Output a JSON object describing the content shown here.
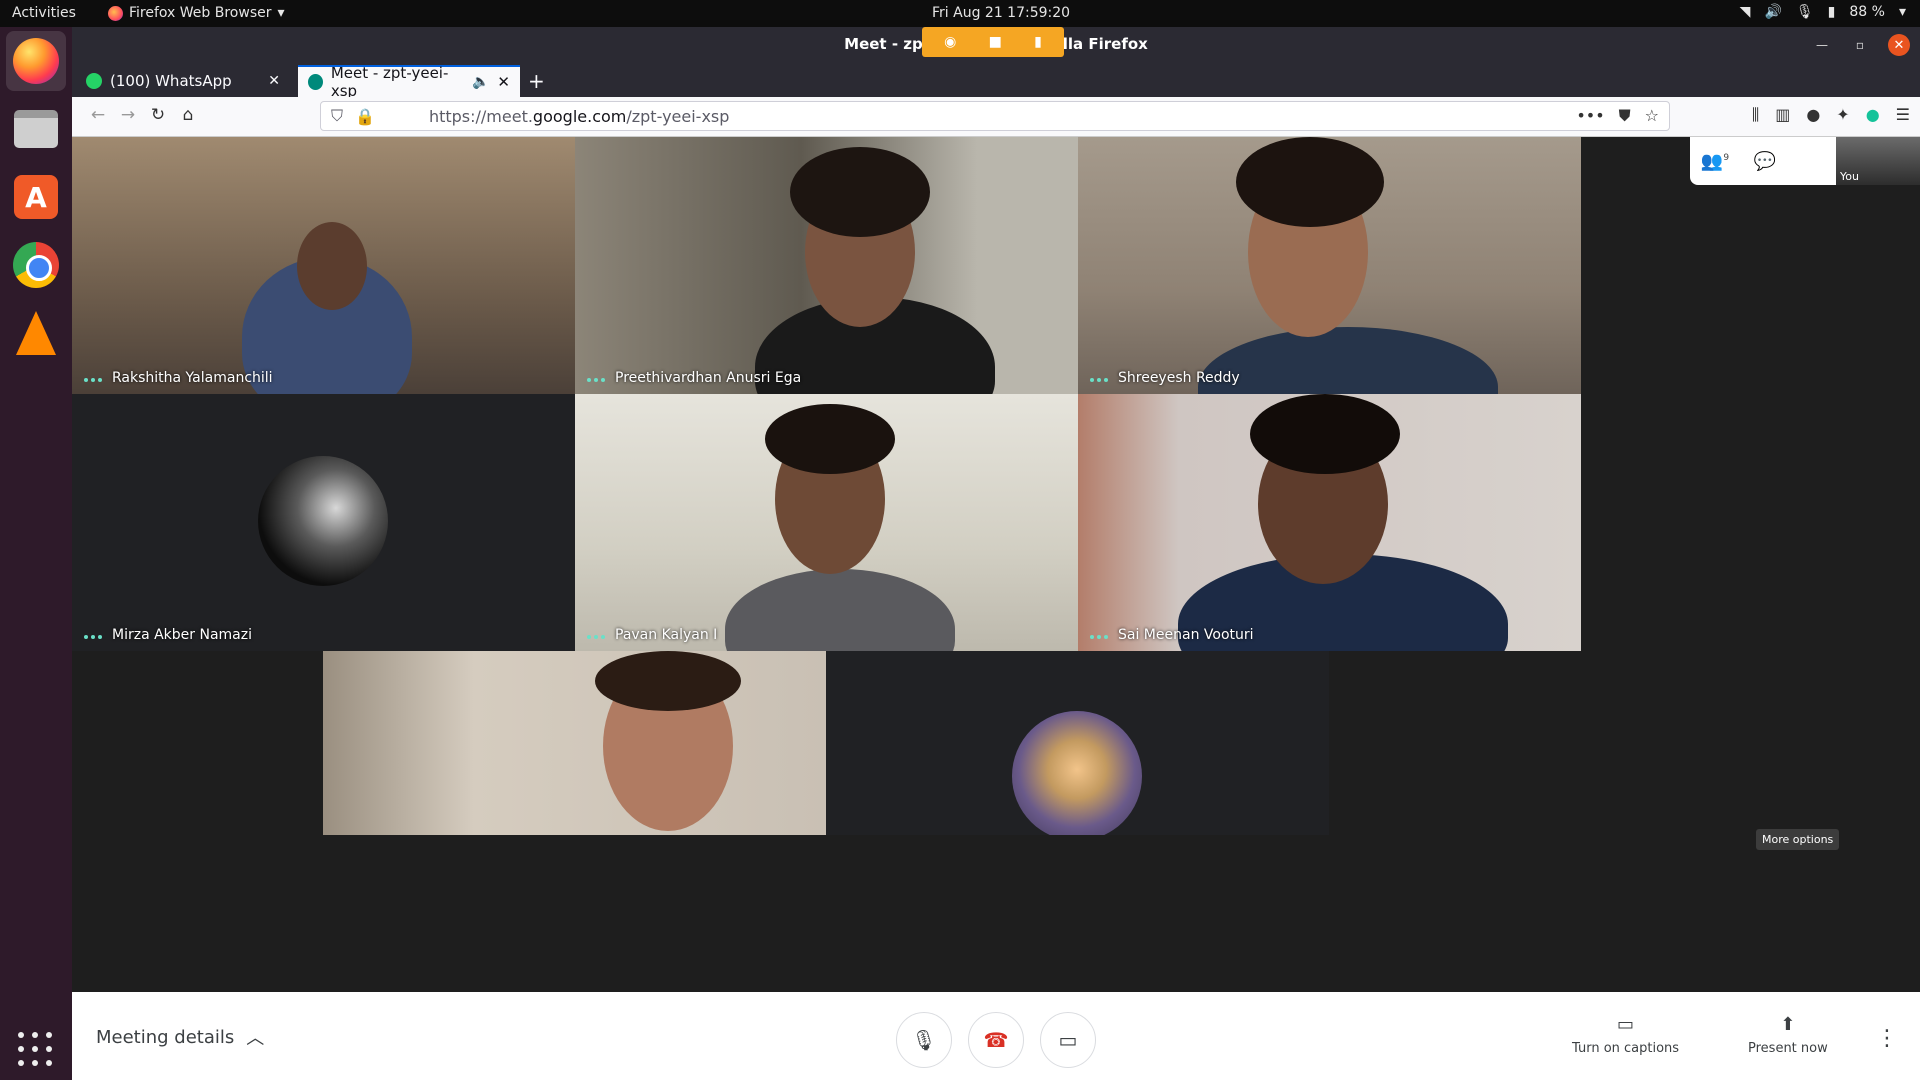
{
  "topbar": {
    "activities": "Activities",
    "app_menu": "Firefox Web Browser",
    "clock": "Fri Aug 21  17:59:20",
    "battery": "88 %"
  },
  "window": {
    "title": "Meet - zpt-yeei-xsp - Mozilla Firefox"
  },
  "tabs": [
    {
      "label": "(100) WhatsApp"
    },
    {
      "label": "Meet - zpt-yeei-xsp"
    }
  ],
  "address": {
    "prefix": "https://meet.",
    "domain": "google.com",
    "path": "/zpt-yeei-xsp"
  },
  "participants": [
    {
      "name": "Rakshitha Yalamanchili"
    },
    {
      "name": "Preethivardhan Anusri Ega"
    },
    {
      "name": "Shreeyesh Reddy"
    },
    {
      "name": "Mirza Akber Namazi"
    },
    {
      "name": "Pavan Kalyan I"
    },
    {
      "name": "Sai Meenan Vooturi"
    }
  ],
  "top_panel": {
    "participant_count": "9",
    "self_label": "You"
  },
  "bottom": {
    "meeting_details": "Meeting details",
    "captions_label": "Turn on captions",
    "present_label": "Present now",
    "more_tooltip": "More options"
  }
}
